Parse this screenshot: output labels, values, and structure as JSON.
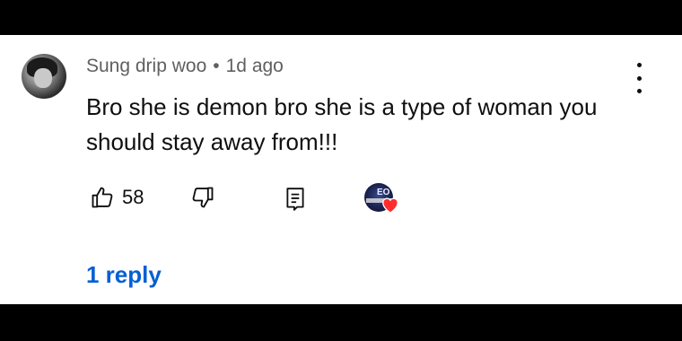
{
  "comment": {
    "author": "Sung drip woo",
    "separator": "•",
    "age": "1d ago",
    "text": "Bro she is demon bro she is a type of woman you should stay away from!!!",
    "like_count": "58",
    "replies_label": "1 reply"
  },
  "icons": {
    "menu": "more-vert-icon",
    "like": "thumb-up-icon",
    "dislike": "thumb-down-icon",
    "reply": "comment-icon",
    "creator_heart": "heart-icon"
  },
  "colors": {
    "reply_link": "#065fd4",
    "heart": "#ff2d2d",
    "meta_text": "#606060"
  }
}
